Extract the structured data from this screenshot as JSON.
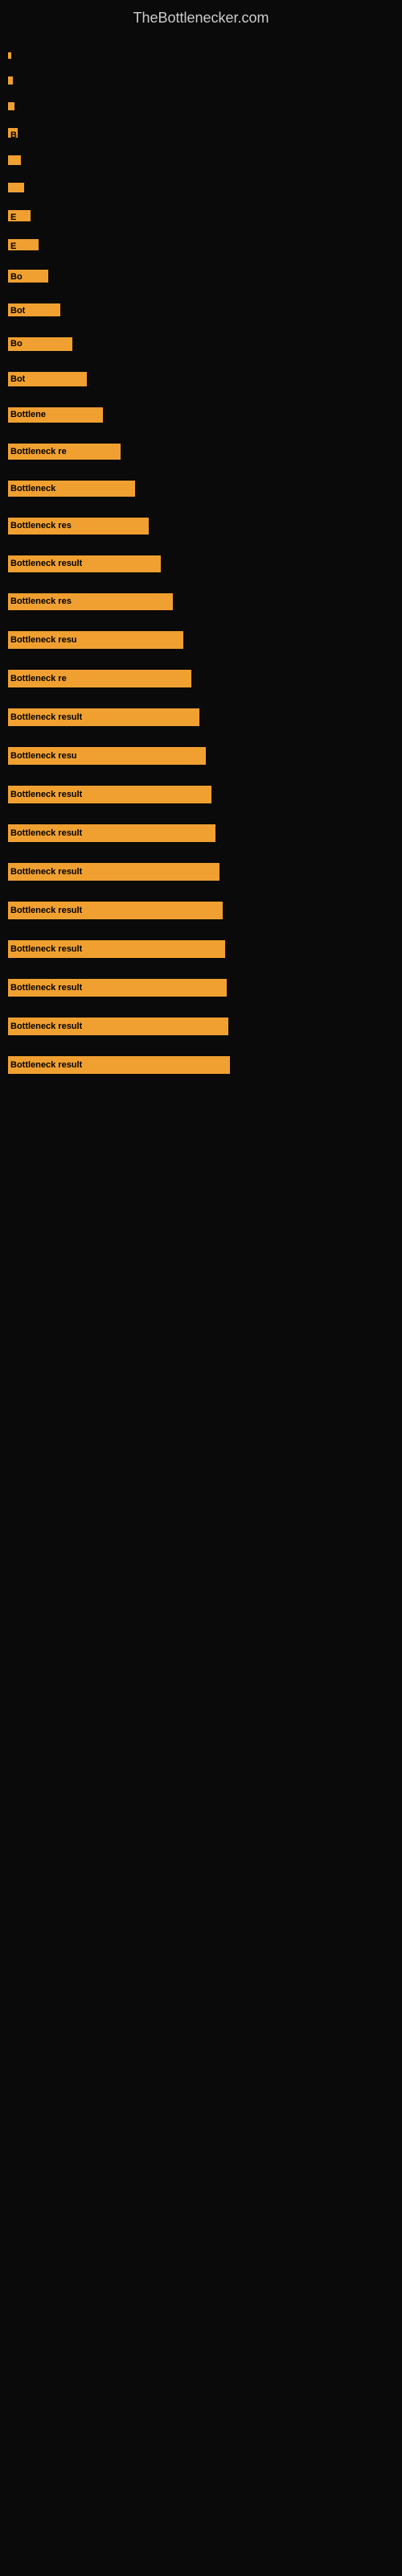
{
  "site": {
    "title": "TheBottlenecker.com"
  },
  "bars": [
    {
      "id": 1,
      "label": "",
      "width_class": "bar-w-1",
      "height": 8
    },
    {
      "id": 2,
      "label": "",
      "width_class": "bar-w-2",
      "height": 10
    },
    {
      "id": 3,
      "label": "",
      "width_class": "bar-w-3",
      "height": 10
    },
    {
      "id": 4,
      "label": "B",
      "width_class": "bar-w-4",
      "height": 12
    },
    {
      "id": 5,
      "label": "",
      "width_class": "bar-w-5",
      "height": 12
    },
    {
      "id": 6,
      "label": "",
      "width_class": "bar-w-6",
      "height": 12
    },
    {
      "id": 7,
      "label": "E",
      "width_class": "bar-w-7",
      "height": 14
    },
    {
      "id": 8,
      "label": "E",
      "width_class": "bar-w-8",
      "height": 14
    },
    {
      "id": 9,
      "label": "Bo",
      "width_class": "bar-w-9",
      "height": 16
    },
    {
      "id": 10,
      "label": "Bot",
      "width_class": "bar-w-10",
      "height": 16
    },
    {
      "id": 11,
      "label": "Bo",
      "width_class": "bar-w-11",
      "height": 17
    },
    {
      "id": 12,
      "label": "Bot",
      "width_class": "bar-w-12",
      "height": 18
    },
    {
      "id": 13,
      "label": "Bottlene",
      "width_class": "bar-w-13",
      "height": 19
    },
    {
      "id": 14,
      "label": "Bottleneck re",
      "width_class": "bar-w-14",
      "height": 20
    },
    {
      "id": 15,
      "label": "Bottleneck",
      "width_class": "bar-w-15",
      "height": 20
    },
    {
      "id": 16,
      "label": "Bottleneck res",
      "width_class": "bar-w-16",
      "height": 21
    },
    {
      "id": 17,
      "label": "Bottleneck result",
      "width_class": "bar-w-17",
      "height": 21
    },
    {
      "id": 18,
      "label": "Bottleneck res",
      "width_class": "bar-w-18",
      "height": 21
    },
    {
      "id": 19,
      "label": "Bottleneck resu",
      "width_class": "bar-w-19",
      "height": 22
    },
    {
      "id": 20,
      "label": "Bottleneck re",
      "width_class": "bar-w-20",
      "height": 22
    },
    {
      "id": 21,
      "label": "Bottleneck result",
      "width_class": "bar-w-21",
      "height": 22
    },
    {
      "id": 22,
      "label": "Bottleneck resu",
      "width_class": "bar-w-22",
      "height": 22
    },
    {
      "id": 23,
      "label": "Bottleneck result",
      "width_class": "bar-w-23",
      "height": 22
    },
    {
      "id": 24,
      "label": "Bottleneck result",
      "width_class": "bar-w-24",
      "height": 22
    },
    {
      "id": 25,
      "label": "Bottleneck result",
      "width_class": "bar-w-25",
      "height": 22
    },
    {
      "id": 26,
      "label": "Bottleneck result",
      "width_class": "bar-w-26",
      "height": 22
    },
    {
      "id": 27,
      "label": "Bottleneck result",
      "width_class": "bar-w-27",
      "height": 22
    },
    {
      "id": 28,
      "label": "Bottleneck result",
      "width_class": "bar-w-28",
      "height": 22
    },
    {
      "id": 29,
      "label": "Bottleneck result",
      "width_class": "bar-w-29",
      "height": 22
    },
    {
      "id": 30,
      "label": "Bottleneck result",
      "width_class": "bar-w-30",
      "height": 22
    }
  ]
}
